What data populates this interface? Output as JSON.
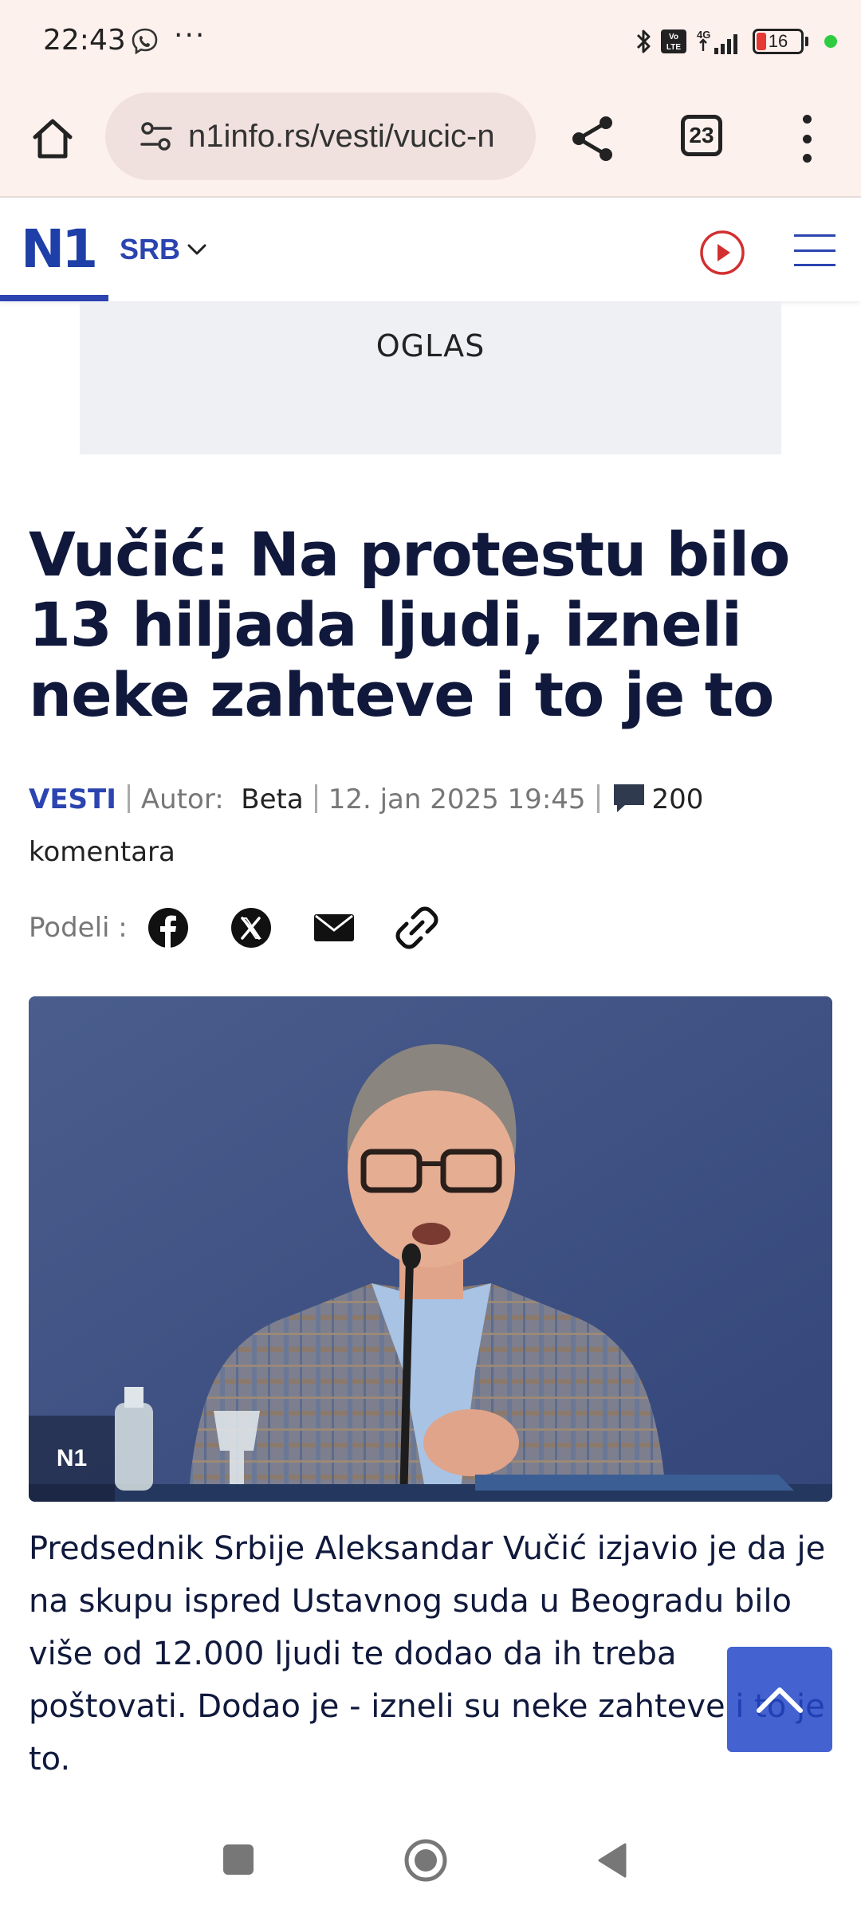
{
  "status_bar": {
    "time": "22:43",
    "overflow": "···",
    "network": "4G",
    "battery": "16",
    "icons": [
      "viber-icon",
      "bluetooth-icon",
      "volte-icon",
      "signal-icon",
      "battery-icon"
    ]
  },
  "browser": {
    "url": "n1info.rs/vesti/vucic-n",
    "tab_count": "23",
    "icons": [
      "home-icon",
      "tune-icon",
      "share-icon",
      "tabs-icon",
      "more-vert-icon"
    ]
  },
  "site": {
    "logo": "N1",
    "language": "SRB",
    "accent": "#2b44b0",
    "icons": [
      "chevron-down-icon",
      "play-icon",
      "hamburger-menu-icon"
    ]
  },
  "ad": {
    "label": "OGLAS"
  },
  "article": {
    "headline": "Vučić: Na protestu bilo 13 hiljada ljudi, izneli neke zahteve i to je to",
    "category": "VESTI",
    "author_label": "Autor:",
    "author": "Beta",
    "date": "12. jan 2025 19:45",
    "comment_count": "200",
    "comment_word": "komentara",
    "share_label": "Podeli :",
    "share_icons": [
      "facebook-icon",
      "x-icon",
      "mail-icon",
      "link-icon"
    ],
    "photo_badge": "N1",
    "lead": "Predsednik Srbije Aleksandar Vučić izjavio je da je na skupu ispred Ustavnog suda u Beogradu bilo više od 12.000 ljudi te dodao da ih treba poštovati. Dodao je - izneli su neke zahteve i to je to."
  },
  "nav": {
    "icons": [
      "recents-icon",
      "home-circle-icon",
      "back-icon"
    ]
  }
}
